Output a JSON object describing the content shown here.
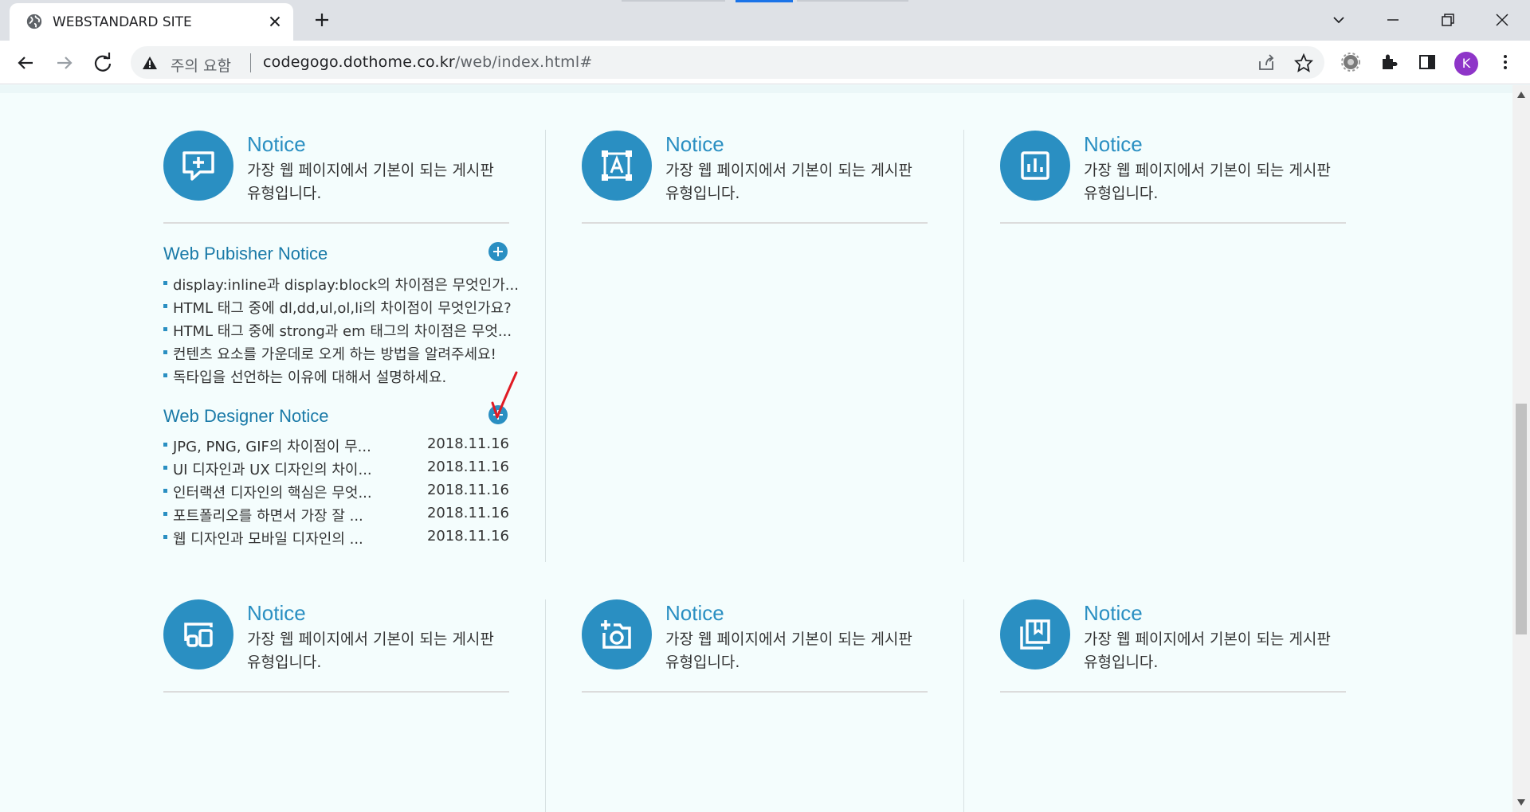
{
  "browser": {
    "tab_title": "WEBSTANDARD SITE",
    "security_label": "주의 요함",
    "url_host": "codegogo.dothome.co.kr",
    "url_path": "/web/index.html#",
    "profile_initial": "K"
  },
  "cards_top": [
    {
      "title": "Notice",
      "line1": "가장 웹 페이지에서 기본이 되는 게시판",
      "line2": "유형입니다.",
      "icon": "add-comment-icon"
    },
    {
      "title": "Notice",
      "line1": "가장 웹 페이지에서 기본이 되는 게시판",
      "line2": "유형입니다.",
      "icon": "text-frame-icon"
    },
    {
      "title": "Notice",
      "line1": "가장 웹 페이지에서 기본이 되는 게시판",
      "line2": "유형입니다.",
      "icon": "bar-chart-icon"
    }
  ],
  "cards_bottom": [
    {
      "title": "Notice",
      "line1": "가장 웹 페이지에서 기본이 되는 게시판",
      "line2": "유형입니다.",
      "icon": "devices-icon"
    },
    {
      "title": "Notice",
      "line1": "가장 웹 페이지에서 기본이 되는 게시판",
      "line2": "유형입니다.",
      "icon": "add-camera-icon"
    },
    {
      "title": "Notice",
      "line1": "가장 웹 페이지에서 기본이 되는 게시판",
      "line2": "유형입니다.",
      "icon": "bookmark-library-icon"
    }
  ],
  "publisher": {
    "heading": "Web Pubisher Notice",
    "items": [
      "display:inline과 display:block의 차이점은 무엇인가...",
      "HTML 태그 중에 dl,dd,ul,ol,li의 차이점이 무엇인가요?",
      "HTML 태그 중에 strong과 em 태그의 차이점은 무엇...",
      "컨텐츠 요소를 가운데로 오게 하는 방법을 알려주세요!",
      "독타입을 선언하는 이유에 대해서 설명하세요."
    ]
  },
  "designer": {
    "heading": "Web Designer Notice",
    "items": [
      {
        "text": "JPG, PNG, GIF의 차이점이 무...",
        "date": "2018.11.16"
      },
      {
        "text": "UI 디자인과 UX 디자인의 차이...",
        "date": "2018.11.16"
      },
      {
        "text": "인터랙션 디자인의 핵심은 무엇...",
        "date": "2018.11.16"
      },
      {
        "text": "포트폴리오를 하면서 가장 잘 ...",
        "date": "2018.11.16"
      },
      {
        "text": "웹 디자인과 모바일 디자인의 ...",
        "date": "2018.11.16"
      }
    ]
  },
  "colors": {
    "accent": "#2a8fc2",
    "heading": "#1a7aa8",
    "background": "#f4fdfd",
    "annotation": "#e01b24"
  }
}
